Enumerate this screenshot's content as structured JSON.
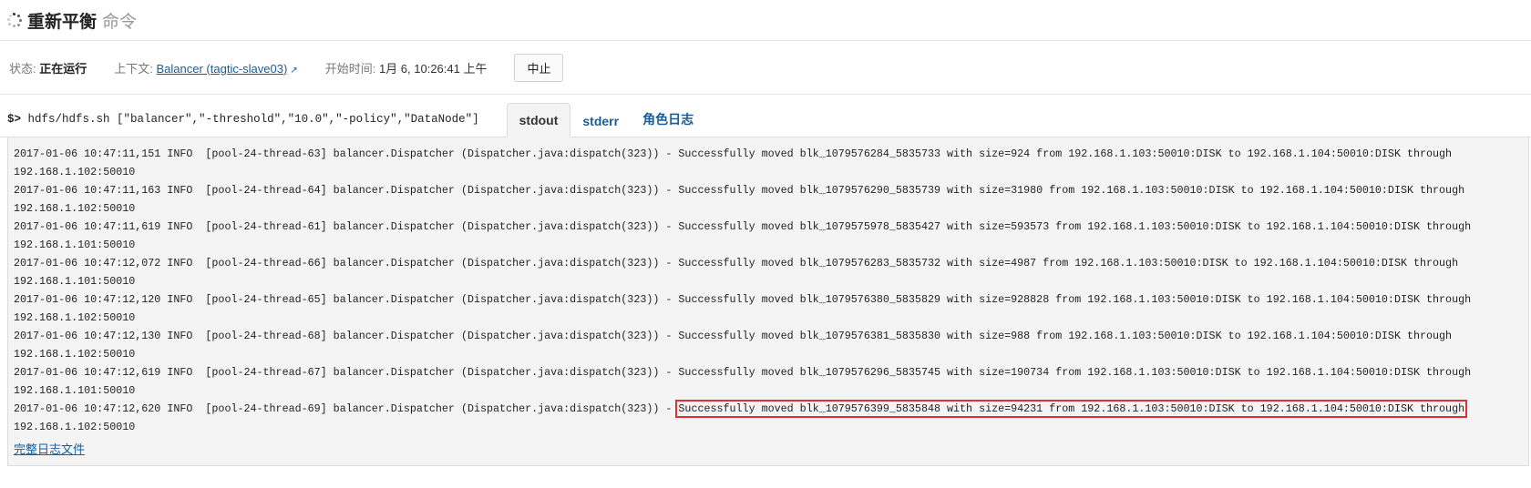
{
  "header": {
    "title": "重新平衡",
    "subtitle": "命令"
  },
  "status": {
    "state_label": "状态:",
    "state_value": "正在运行",
    "context_label": "上下文:",
    "context_link": "Balancer (tagtic-slave03)",
    "start_label": "开始时间:",
    "start_value": "1月 6, 10:26:41 上午",
    "abort_label": "中止"
  },
  "command": {
    "prompt": "$>",
    "text": "hdfs/hdfs.sh [\"balancer\",\"-threshold\",\"10.0\",\"-policy\",\"DataNode\"]"
  },
  "tabs": [
    {
      "label": "stdout"
    },
    {
      "label": "stderr"
    },
    {
      "label": "角色日志"
    }
  ],
  "log": {
    "lines": [
      {
        "prefix": "2017-01-06 10:47:11,151 INFO  [pool-24-thread-63] balancer.Dispatcher (Dispatcher.java:dispatch(323)) - ",
        "msg": "Successfully moved blk_1079576284_5835733 with size=924 from 192.168.1.103:50010:DISK to 192.168.1.104:50010:DISK through",
        "cont": "192.168.1.102:50010"
      },
      {
        "prefix": "2017-01-06 10:47:11,163 INFO  [pool-24-thread-64] balancer.Dispatcher (Dispatcher.java:dispatch(323)) - ",
        "msg": "Successfully moved blk_1079576290_5835739 with size=31980 from 192.168.1.103:50010:DISK to 192.168.1.104:50010:DISK through",
        "cont": "192.168.1.102:50010"
      },
      {
        "prefix": "2017-01-06 10:47:11,619 INFO  [pool-24-thread-61] balancer.Dispatcher (Dispatcher.java:dispatch(323)) - ",
        "msg": "Successfully moved blk_1079575978_5835427 with size=593573 from 192.168.1.103:50010:DISK to 192.168.1.104:50010:DISK through",
        "cont": "192.168.1.101:50010"
      },
      {
        "prefix": "2017-01-06 10:47:12,072 INFO  [pool-24-thread-66] balancer.Dispatcher (Dispatcher.java:dispatch(323)) - ",
        "msg": "Successfully moved blk_1079576283_5835732 with size=4987 from 192.168.1.103:50010:DISK to 192.168.1.104:50010:DISK through",
        "cont": "192.168.1.101:50010"
      },
      {
        "prefix": "2017-01-06 10:47:12,120 INFO  [pool-24-thread-65] balancer.Dispatcher (Dispatcher.java:dispatch(323)) - ",
        "msg": "Successfully moved blk_1079576380_5835829 with size=928828 from 192.168.1.103:50010:DISK to 192.168.1.104:50010:DISK through",
        "cont": "192.168.1.102:50010"
      },
      {
        "prefix": "2017-01-06 10:47:12,130 INFO  [pool-24-thread-68] balancer.Dispatcher (Dispatcher.java:dispatch(323)) - ",
        "msg": "Successfully moved blk_1079576381_5835830 with size=988 from 192.168.1.103:50010:DISK to 192.168.1.104:50010:DISK through",
        "cont": "192.168.1.102:50010"
      },
      {
        "prefix": "2017-01-06 10:47:12,619 INFO  [pool-24-thread-67] balancer.Dispatcher (Dispatcher.java:dispatch(323)) - ",
        "msg": "Successfully moved blk_1079576296_5835745 with size=190734 from 192.168.1.103:50010:DISK to 192.168.1.104:50010:DISK through",
        "cont": "192.168.1.101:50010"
      },
      {
        "prefix": "2017-01-06 10:47:12,620 INFO  [pool-24-thread-69] balancer.Dispatcher (Dispatcher.java:dispatch(323)) - ",
        "msg": "Successfully moved blk_1079576399_5835848 with size=94231 from 192.168.1.103:50010:DISK to 192.168.1.104:50010:DISK through",
        "cont": "192.168.1.102:50010"
      }
    ],
    "full_log_link": "完整日志文件"
  }
}
